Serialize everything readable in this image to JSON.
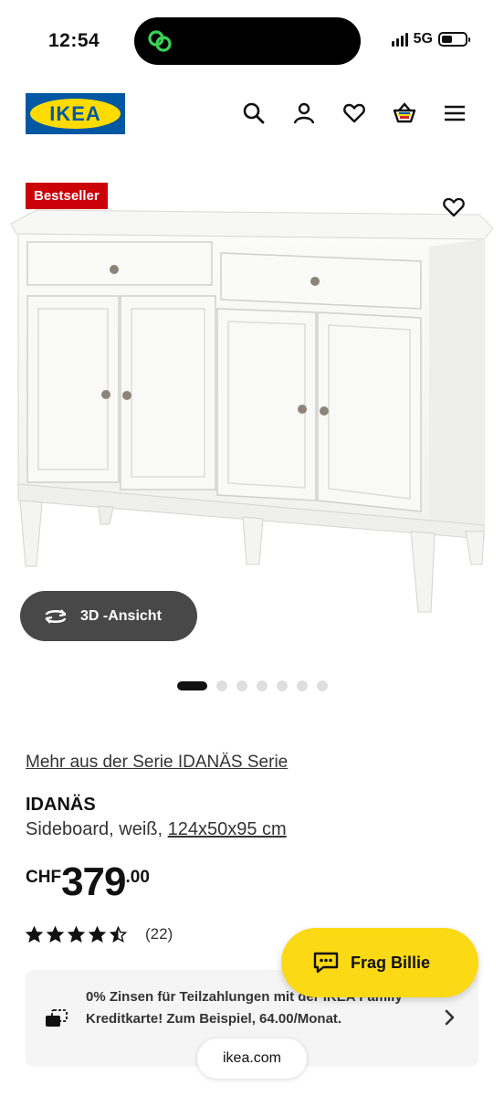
{
  "status_bar": {
    "time": "12:54",
    "network": "5G",
    "battery_level": 0.45
  },
  "header": {
    "logo_text": "IKEA",
    "icons": [
      "search-icon",
      "account-icon",
      "heart-icon",
      "basket-icon",
      "menu-icon"
    ]
  },
  "product": {
    "badge": "Bestseller",
    "view3d_label": "3D -Ansicht",
    "carousel": {
      "total": 7,
      "active_index": 0
    },
    "series_link": "Mehr aus der Serie IDANÄS Serie",
    "name": "IDANÄS",
    "description": "Sideboard, weiß,",
    "dimensions": "124x50x95 cm",
    "price": {
      "currency": "CHF",
      "integer": "379",
      "decimal": ".00"
    },
    "rating": {
      "stars": 4.5,
      "count": "(22)"
    }
  },
  "finance": {
    "text": "0% Zinsen für Teilzahlungen mit der IKEA Family Kreditkarte! Zum Beispiel, 64.00/Monat."
  },
  "chat": {
    "label": "Frag Billie"
  },
  "browser": {
    "url": "ikea.com"
  },
  "colors": {
    "ikea_blue": "#0058a3",
    "ikea_yellow": "#ffdb00",
    "badge_red": "#cc0008",
    "chat_yellow": "#fbd914"
  }
}
